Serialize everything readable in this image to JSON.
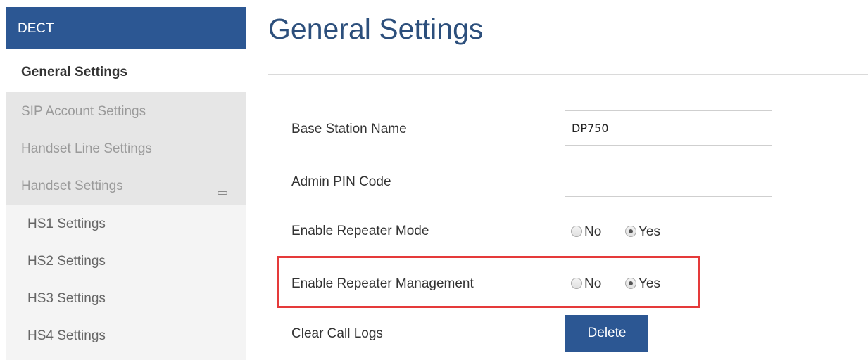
{
  "sidebar": {
    "section_title": "DECT",
    "active_item": "General Settings",
    "items": [
      {
        "label": "SIP Account Settings"
      },
      {
        "label": "Handset Line Settings"
      },
      {
        "label": "Handset Settings"
      }
    ],
    "handset_subitems": [
      {
        "label": "HS1 Settings"
      },
      {
        "label": "HS2 Settings"
      },
      {
        "label": "HS3 Settings"
      },
      {
        "label": "HS4 Settings"
      }
    ],
    "collapse_icon": "minus-collapse-icon"
  },
  "main": {
    "title": "General Settings",
    "fields": {
      "base_station_name": {
        "label": "Base Station Name",
        "value": "DP750"
      },
      "admin_pin_code": {
        "label": "Admin PIN Code",
        "value": ""
      },
      "enable_repeater_mode": {
        "label": "Enable Repeater Mode",
        "options": [
          "No",
          "Yes"
        ],
        "selected": "Yes"
      },
      "enable_repeater_management": {
        "label": "Enable Repeater Management",
        "options": [
          "No",
          "Yes"
        ],
        "selected": "Yes"
      },
      "clear_call_logs": {
        "label": "Clear Call Logs",
        "button_label": "Delete"
      }
    }
  },
  "colors": {
    "brand": "#2c5793",
    "highlight": "#e53a3a",
    "title": "#2c4f7c"
  }
}
